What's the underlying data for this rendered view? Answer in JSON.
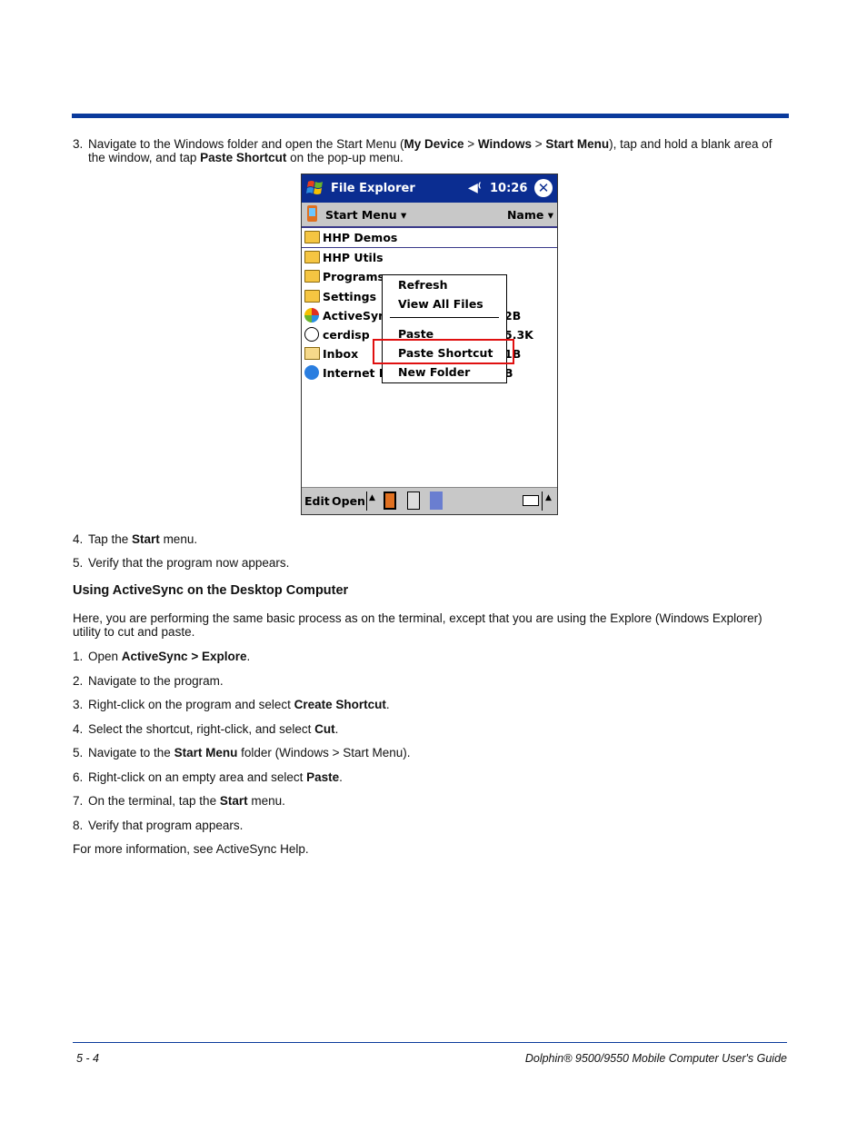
{
  "intro_step": {
    "number": "3.",
    "parts": [
      "Navigate to the Windows folder and open the Start Menu (",
      "My Device",
      " > ",
      "Windows",
      " > ",
      "Start Menu",
      "), tap and hold a blank area of the window, and tap ",
      "Paste Shortcut",
      " on the pop-up menu."
    ]
  },
  "pda": {
    "title": "File Explorer",
    "clock": "10:26",
    "speaker_icon": "speaker-icon",
    "close_label": "✕",
    "folder": "Start Menu ▾",
    "sort": "Name ▾",
    "files": [
      {
        "name": "HHP Demos",
        "icon": "folder-icon",
        "size": ""
      },
      {
        "name": "HHP Utils",
        "icon": "folder-icon",
        "size": ""
      },
      {
        "name": "Programs",
        "icon": "folder-icon",
        "size": ""
      },
      {
        "name": "Settings",
        "icon": "folder-icon",
        "size": ""
      },
      {
        "name": "ActiveSyn",
        "icon": "activesync-icon",
        "size": "2B"
      },
      {
        "name": "cerdisp",
        "icon": "cerdisp-icon",
        "size": "5.3K"
      },
      {
        "name": "Inbox",
        "icon": "inbox-icon",
        "size": "1B"
      },
      {
        "name": "Internet E",
        "icon": "internet-explorer-icon",
        "size": "B"
      }
    ],
    "popup_menu": [
      "Refresh",
      "View All Files",
      "Paste",
      "Paste Shortcut",
      "New Folder"
    ],
    "highlighted_item": "Paste Shortcut",
    "bottom_bar": {
      "edit": "Edit",
      "open": "Open",
      "caret": "▲"
    }
  },
  "steps_a": [
    {
      "number": "4.",
      "parts": [
        "Tap the ",
        "Start",
        " menu."
      ]
    },
    {
      "number": "5.",
      "parts": [
        "Verify that the program now appears."
      ]
    }
  ],
  "section_heading": "Using ActiveSync on the Desktop Computer",
  "section_intro": "Here, you are performing the same basic process as on the terminal, except that you are using the Explore (Windows Explorer) utility to cut and paste.",
  "steps_b": [
    {
      "number": "1.",
      "parts": [
        "Open ",
        "ActiveSync > Explore",
        "."
      ]
    },
    {
      "number": "2.",
      "parts": [
        "Navigate to the program."
      ]
    },
    {
      "number": "3.",
      "parts": [
        "Right-click on the program and select ",
        "Create Shortcut",
        "."
      ]
    },
    {
      "number": "4.",
      "parts": [
        "Select the shortcut, right-click, and select ",
        "Cut",
        "."
      ]
    },
    {
      "number": "5.",
      "parts": [
        "Navigate to the ",
        "Start Menu",
        " folder (Windows > Start Menu)."
      ]
    },
    {
      "number": "6.",
      "parts": [
        "Right-click on an empty area and select ",
        "Paste",
        "."
      ]
    },
    {
      "number": "7.",
      "parts": [
        "On the terminal, tap the ",
        "Start",
        " menu."
      ]
    },
    {
      "number": "8.",
      "parts": [
        "Verify that program appears."
      ]
    }
  ],
  "closing_note": "For more information, see ActiveSync Help.",
  "footer": {
    "page_number": "5 - 4",
    "guide_title": "Dolphin® 9500/9550 Mobile Computer User's Guide"
  },
  "colors": {
    "rule": "#0a3a9c",
    "titlebar": "#0b2d91",
    "highlight": "#e01010"
  }
}
